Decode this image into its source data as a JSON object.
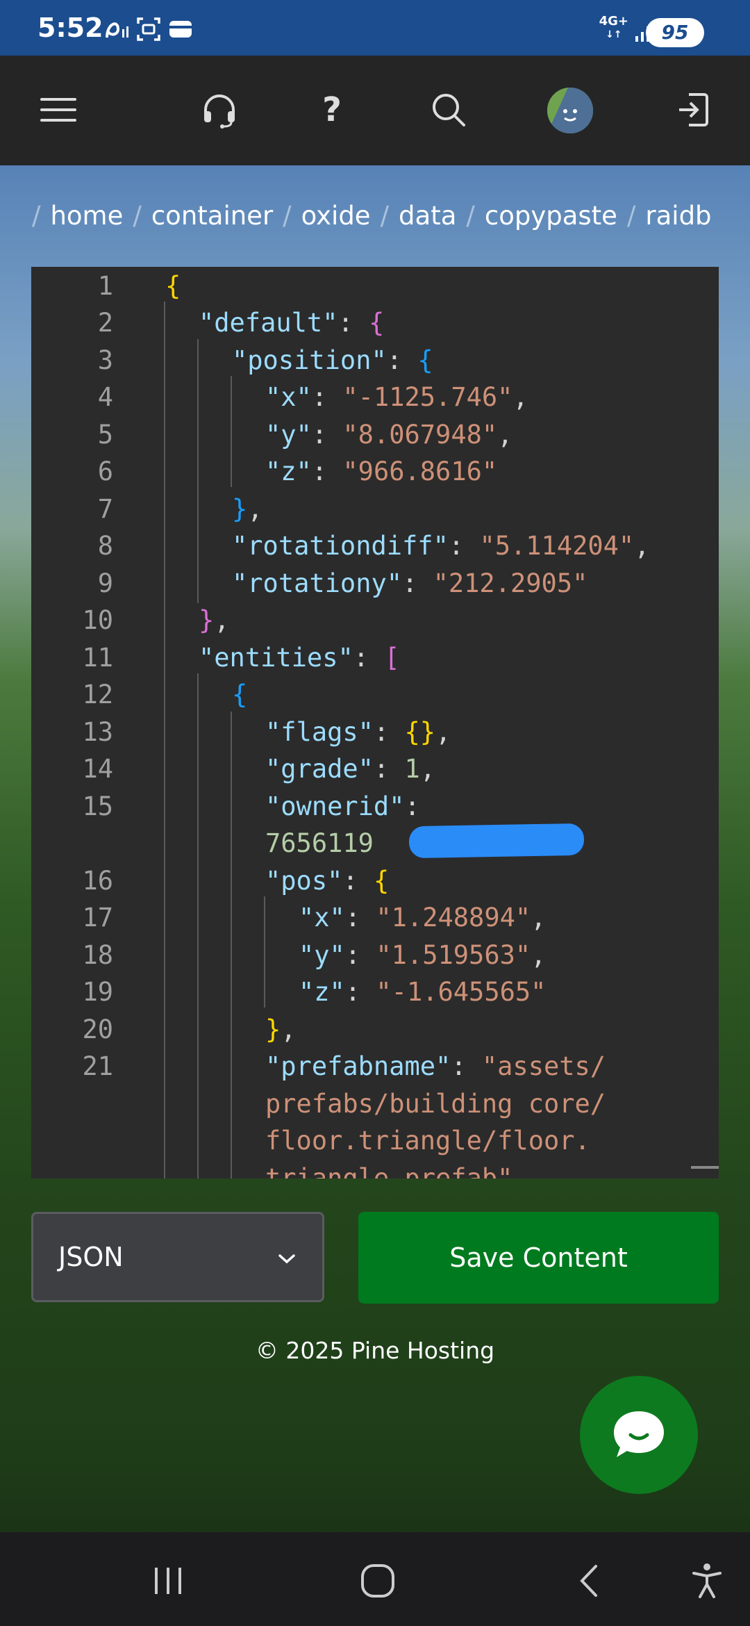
{
  "status_bar": {
    "time": "5:52",
    "network": "4G+",
    "battery": "95"
  },
  "breadcrumb": [
    "home",
    "container",
    "oxide",
    "data",
    "copypaste",
    "raidb"
  ],
  "editor": {
    "line_numbers": [
      "1",
      "2",
      "3",
      "4",
      "5",
      "6",
      "7",
      "8",
      "9",
      "10",
      "11",
      "12",
      "13",
      "14",
      "15",
      "16",
      "17",
      "18",
      "19",
      "20",
      "21"
    ]
  },
  "controls": {
    "language_selected": "JSON",
    "save_label": "Save Content"
  },
  "footer": {
    "copyright": "© 2025 Pine Hosting"
  },
  "code": {
    "default_key": "\"default\"",
    "position_key": "\"position\"",
    "x_key": "\"x\"",
    "y_key": "\"y\"",
    "z_key": "\"z\"",
    "pos_x": "\"-1125.746\"",
    "pos_y": "\"8.067948\"",
    "pos_z": "\"966.8616\"",
    "rotationdiff_key": "\"rotationdiff\"",
    "rotationdiff": "\"5.114204\"",
    "rotationy_key": "\"rotationy\"",
    "rotationy": "\"212.2905\"",
    "entities_key": "\"entities\"",
    "flags_key": "\"flags\"",
    "grade_key": "\"grade\"",
    "grade": "1",
    "ownerid_key": "\"ownerid\"",
    "ownerid_visible": "7656119",
    "pos_key": "\"pos\"",
    "e_x": "\"1.248894\"",
    "e_y": "\"1.519563\"",
    "e_z": "\"-1.645565\"",
    "prefabname_key": "\"prefabname\"",
    "prefab_line1": "\"assets/",
    "prefab_line2": "prefabs/building core/",
    "prefab_line3": "floor.triangle/floor.",
    "prefab_line4": "triangle.prefab\""
  }
}
